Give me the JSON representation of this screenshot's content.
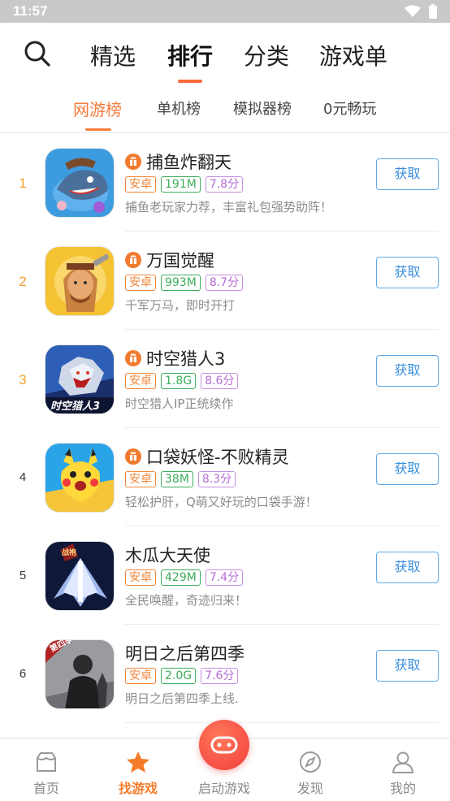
{
  "status_bar": {
    "time": "11:57"
  },
  "top_nav": {
    "tabs": [
      {
        "label": "精选"
      },
      {
        "label": "排行"
      },
      {
        "label": "分类"
      },
      {
        "label": "游戏单"
      }
    ],
    "active": "排行"
  },
  "sub_nav": {
    "tabs": [
      {
        "label": "网游榜"
      },
      {
        "label": "单机榜"
      },
      {
        "label": "模拟器榜"
      },
      {
        "label": "0元畅玩"
      }
    ],
    "active": "网游榜"
  },
  "apps": [
    {
      "rank": "1",
      "name": "捕鱼炸翻天",
      "gift": true,
      "platform": "安卓",
      "size": "191M",
      "score": "7.8分",
      "desc": "捕鱼老玩家力荐，丰富礼包强势助阵！",
      "button": "获取"
    },
    {
      "rank": "2",
      "name": "万国觉醒",
      "gift": true,
      "platform": "安卓",
      "size": "993M",
      "score": "8.7分",
      "desc": "千军万马，即时开打",
      "button": "获取"
    },
    {
      "rank": "3",
      "name": "时空猎人3",
      "gift": true,
      "platform": "安卓",
      "size": "1.8G",
      "score": "8.6分",
      "desc": "时空猎人IP正统续作",
      "button": "获取"
    },
    {
      "rank": "4",
      "name": "口袋妖怪-不败精灵",
      "gift": true,
      "platform": "安卓",
      "size": "38M",
      "score": "8.3分",
      "desc": "轻松护肝，Q萌又好玩的口袋手游！",
      "button": "获取"
    },
    {
      "rank": "5",
      "name": "木瓜大天使",
      "gift": false,
      "platform": "安卓",
      "size": "429M",
      "score": "7.4分",
      "desc": "全民唤醒，奇迹归来！",
      "button": "获取"
    },
    {
      "rank": "6",
      "name": "明日之后第四季",
      "gift": false,
      "platform": "安卓",
      "size": "2.0G",
      "score": "7.6分",
      "desc": "明日之后第四季上线.",
      "button": "获取"
    }
  ],
  "app_icon_text": {
    "shikong": "时空猎人3",
    "mingri": "第四季",
    "mugua": "战袍"
  },
  "bottom_nav": {
    "items": [
      {
        "label": "首页"
      },
      {
        "label": "找游戏"
      },
      {
        "label": "启动游戏"
      },
      {
        "label": "发现"
      },
      {
        "label": "我的"
      }
    ],
    "active": "找游戏"
  },
  "colors": {
    "accent": "#f57c3b",
    "button_blue": "#3b8fdc",
    "rank_top": "#f0a02a"
  }
}
